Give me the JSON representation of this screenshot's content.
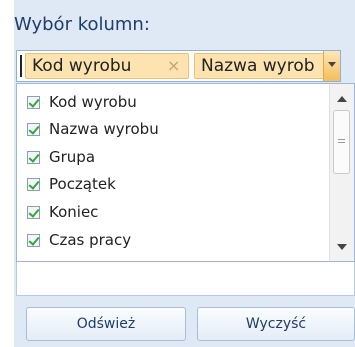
{
  "panel": {
    "title": "Wybór kolumn:"
  },
  "selector": {
    "tags": [
      {
        "label": "Kod wyrobu",
        "remove": "×"
      },
      {
        "label": "Nazwa wyrob"
      }
    ],
    "accent_color": "#f6bd5a"
  },
  "list": {
    "items": [
      {
        "label": "Kod wyrobu",
        "checked": true
      },
      {
        "label": "Nazwa wyrobu",
        "checked": true
      },
      {
        "label": "Grupa",
        "checked": true
      },
      {
        "label": "Początek",
        "checked": true
      },
      {
        "label": "Koniec",
        "checked": true
      },
      {
        "label": "Czas pracy",
        "checked": true
      }
    ]
  },
  "buttons": {
    "refresh": "Odśwież",
    "clear": "Wyczyść"
  }
}
